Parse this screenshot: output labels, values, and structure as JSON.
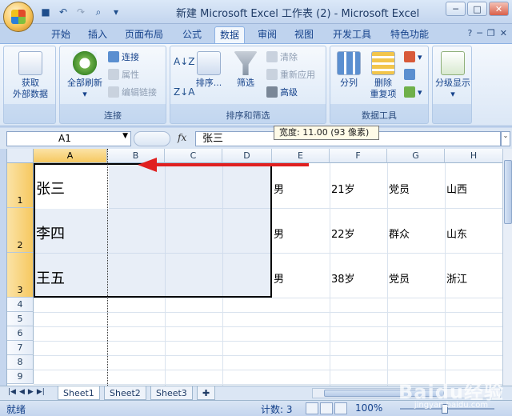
{
  "window": {
    "title": "新建 Microsoft Excel 工作表 (2) - Microsoft Excel",
    "controls": [
      "─",
      "□",
      "✕"
    ],
    "doc_controls": [
      "─",
      "❐",
      "✕"
    ]
  },
  "tabs": [
    "开始",
    "插入",
    "页面布局",
    "公式",
    "数据",
    "审阅",
    "视图",
    "开发工具",
    "特色功能"
  ],
  "active_tab": "数据",
  "ribbon": {
    "get_external": "获取\n外部数据",
    "get_external_l1": "获取",
    "get_external_l2": "外部数据",
    "refresh_all": "全部刷新",
    "conn": "连接",
    "props": "属性",
    "edit_links": "编辑链接",
    "group_conn": "连接",
    "sort": "排序...",
    "filter": "筛选",
    "clear": "清除",
    "reapply": "重新应用",
    "advanced": "高级",
    "group_sort": "排序和筛选",
    "split": "分列",
    "remove_dup_l1": "删除",
    "remove_dup_l2": "重复项",
    "group_tools": "数据工具",
    "outline": "分级显示"
  },
  "formula_bar": {
    "name_box": "A1",
    "fx": "fx",
    "value": "张三"
  },
  "tooltip": "宽度: 11.00 (93 像素)",
  "columns": [
    "A",
    "B",
    "C",
    "D",
    "E",
    "F",
    "G",
    "H"
  ],
  "rows": [
    "1",
    "2",
    "3",
    "4",
    "5",
    "6",
    "7",
    "8",
    "9"
  ],
  "cells": {
    "r1": {
      "name": "张三",
      "gender": "男",
      "age": "21岁",
      "status": "党员",
      "province": "山西"
    },
    "r2": {
      "name": "李四",
      "gender": "男",
      "age": "22岁",
      "status": "群众",
      "province": "山东"
    },
    "r3": {
      "name": "王五",
      "gender": "男",
      "age": "38岁",
      "status": "党员",
      "province": "浙江"
    }
  },
  "sheets": [
    "Sheet1",
    "Sheet2",
    "Sheet3"
  ],
  "active_sheet": "Sheet1",
  "status": {
    "ready": "就绪",
    "count": "计数: 3",
    "zoom": "100%"
  },
  "watermark": {
    "text": "Baidu经验",
    "sub": "jingyan.baidu.com"
  },
  "colors": {
    "accent_arrow": "#e02020",
    "selected_header": "#f6c860"
  },
  "icons": [
    "office-button-icon",
    "save-icon",
    "undo-icon",
    "redo-icon",
    "print-preview-icon",
    "help-icon"
  ]
}
